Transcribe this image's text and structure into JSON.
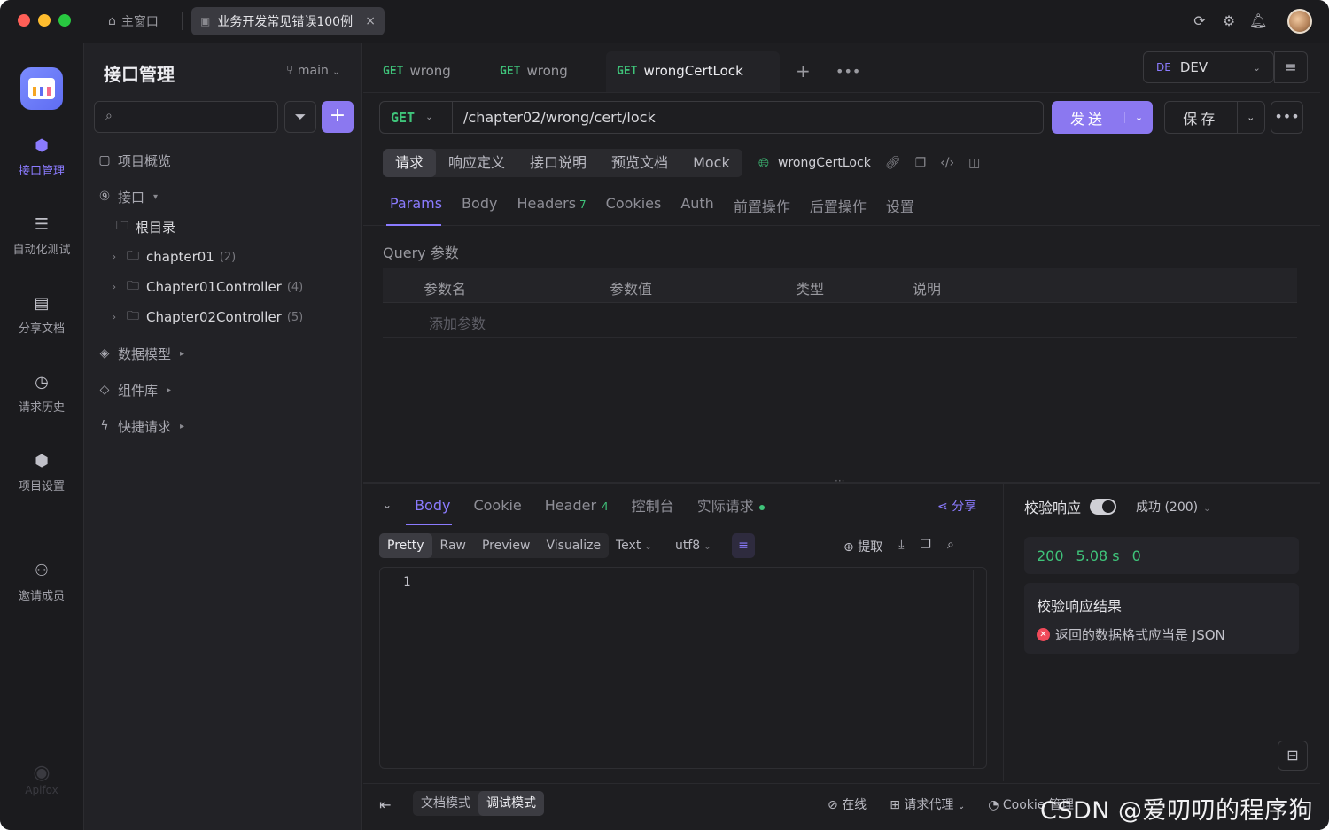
{
  "titlebar": {
    "home_tab": "主窗口",
    "active_tab": "业务开发常见错误100例",
    "close": "×"
  },
  "rail": {
    "items": [
      {
        "label": "接口管理",
        "icon": "api-icon",
        "active": true
      },
      {
        "label": "自动化测试",
        "icon": "automation-icon"
      },
      {
        "label": "分享文档",
        "icon": "book-icon"
      },
      {
        "label": "请求历史",
        "icon": "clock-icon"
      },
      {
        "label": "项目设置",
        "icon": "settings-icon"
      },
      {
        "label": "邀请成员",
        "icon": "add-user-icon"
      }
    ],
    "brand": "Apifox"
  },
  "sidebar": {
    "title": "接口管理",
    "branch": "main",
    "search_placeholder": "",
    "tree": {
      "overview": "项目概览",
      "interfaces": "接口",
      "root": "根目录",
      "folders": [
        {
          "name": "chapter01",
          "count": "(2)"
        },
        {
          "name": "Chapter01Controller",
          "count": "(4)"
        },
        {
          "name": "Chapter02Controller",
          "count": "(5)"
        }
      ],
      "data_models": "数据模型",
      "components": "组件库",
      "quick_requests": "快捷请求"
    }
  },
  "request_tabs": [
    {
      "method": "GET",
      "name": "wrong"
    },
    {
      "method": "GET",
      "name": "wrong"
    },
    {
      "method": "GET",
      "name": "wrongCertLock",
      "active": true
    }
  ],
  "env": {
    "badge": "DE",
    "name": "DEV"
  },
  "request": {
    "method": "GET",
    "url": "/chapter02/wrong/cert/lock",
    "send_label": "发送",
    "save_label": "保存"
  },
  "mode_tabs": [
    "请求",
    "响应定义",
    "接口说明",
    "预览文档",
    "Mock"
  ],
  "api_name": "wrongCertLock",
  "param_tabs": [
    {
      "label": "Params",
      "active": true
    },
    {
      "label": "Body"
    },
    {
      "label": "Headers",
      "badge": "7"
    },
    {
      "label": "Cookies"
    },
    {
      "label": "Auth"
    },
    {
      "label": "前置操作"
    },
    {
      "label": "后置操作"
    },
    {
      "label": "设置"
    }
  ],
  "query": {
    "title": "Query 参数",
    "columns": [
      "参数名",
      "参数值",
      "类型",
      "说明"
    ],
    "add_placeholder": "添加参数"
  },
  "response": {
    "tabs": [
      {
        "label": "Body",
        "active": true
      },
      {
        "label": "Cookie"
      },
      {
        "label": "Header",
        "badge": "4"
      },
      {
        "label": "控制台"
      },
      {
        "label": "实际请求",
        "dot": true
      }
    ],
    "share": "分享",
    "formats": [
      "Pretty",
      "Raw",
      "Preview",
      "Visualize"
    ],
    "type": "Text",
    "encoding": "utf8",
    "extract": "提取",
    "line_number": "1"
  },
  "verify": {
    "label": "校验响应",
    "status": "成功 (200)",
    "code": "200",
    "time": "5.08 s",
    "size": "0",
    "result_title": "校验响应结果",
    "error": "返回的数据格式应当是 JSON"
  },
  "statusbar": {
    "doc_mode": "文档模式",
    "debug_mode": "调试模式",
    "online": "在线",
    "proxy": "请求代理",
    "cookie": "Cookie 管理"
  },
  "watermark": "CSDN @爱叨叨的程序狗",
  "colors": {
    "accent": "#8b78f0",
    "get": "#3fc47a",
    "error": "#f04a5a"
  }
}
